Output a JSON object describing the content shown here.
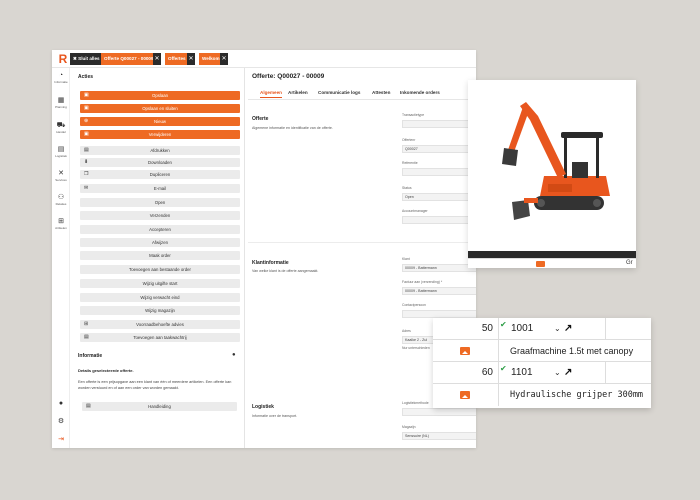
{
  "topbar": {
    "tabs": [
      {
        "label": "✖ Sluit alles",
        "color": "#2b2b2b"
      },
      {
        "label": "Offerte Q00027 - 00009",
        "color": "#ee6a23"
      },
      {
        "label": "Offertes",
        "color": "#ee6a23"
      },
      {
        "label": "Welkom",
        "color": "#ee6a23"
      }
    ],
    "logo": "R"
  },
  "sidebar": {
    "items": [
      {
        "icon": "dashboard-icon",
        "label": "Informatie"
      },
      {
        "icon": "calendar-icon",
        "label": "Planning"
      },
      {
        "icon": "cart-icon",
        "label": "Handel"
      },
      {
        "icon": "logistics-icon",
        "label": "Logistiek"
      },
      {
        "icon": "tools-icon",
        "label": "Services"
      },
      {
        "icon": "relations-icon",
        "label": "Relaties"
      },
      {
        "icon": "articles-icon",
        "label": "Artikelen"
      }
    ]
  },
  "actions": {
    "title": "Acties",
    "orange_buttons": [
      "Opslaan",
      "Opslaan en sluiten",
      "Nieuw",
      "Verwijderen"
    ],
    "gray_buttons": [
      "Afdrukken",
      "Downloaden",
      "Dupliceren",
      "E-mail",
      "Open",
      "Verzenden",
      "Accepteren",
      "Afwijzen",
      "Maak order",
      "Toevoegen aan bestaande order",
      "Wijzig uitgifte start",
      "Wijzig verwacht eind",
      "Wijzig magazijn",
      "Voorraadbehoefte advies",
      "Toevoegen aan taakwachtrij"
    ]
  },
  "info": {
    "title": "Informatie",
    "subtitle": "Details geselecteerde offerte.",
    "body": "Een offerte is een prijsopgave aan een klant van één of meerdere artikelen. Een offerte kan worden verstuurd en of aan een order van worden gemaakt.",
    "manual_button": "Handleiding"
  },
  "detail": {
    "title": "Offerte: Q00027 - 00009",
    "tabs": [
      "Algemeen",
      "Artikelen",
      "Communicatie logs",
      "Attesten",
      "Inkomende orders"
    ],
    "offerte": {
      "title": "Offerte",
      "desc": "Algemene informatie en identificatie van de offerte.",
      "fields": [
        {
          "label": "Transactietype",
          "value": ""
        },
        {
          "label": "Offertenr",
          "value": "Q00027"
        },
        {
          "label": "Referentie",
          "value": ""
        },
        {
          "label": "Status",
          "value": "Open"
        },
        {
          "label": "Accountmanager",
          "value": ""
        }
      ]
    },
    "klant": {
      "title": "Klantinformatie",
      "desc": "Van welke klant is de offerte aangemaakt.",
      "fields": [
        {
          "label": "Klant",
          "value": "00009 - Battermann"
        },
        {
          "label": "Factuur aan (verzending) *",
          "value": "00009 - Battermann"
        },
        {
          "label": "Contactpersoon",
          "value": ""
        },
        {
          "label": "Adres",
          "value": "Kaalke 2 - Zul"
        }
      ],
      "note": "Nur unterschieden"
    },
    "logistiek": {
      "title": "Logistiek",
      "desc": "Informatie over de transport.",
      "fields": [
        {
          "label": "Logistiekmethode",
          "value": ""
        },
        {
          "label": "Magazijn",
          "value": "Senssuire (NL)"
        }
      ]
    }
  },
  "image_card": {
    "footer_text": "Gr"
  },
  "lines": [
    {
      "qty": "50",
      "code": "1001",
      "desc": "Graafmachine 1.5t met canopy"
    },
    {
      "qty": "60",
      "code": "1101",
      "desc": "Hydraulische grijper 300mm"
    }
  ],
  "colors": {
    "accent": "#ee6a23",
    "check": "#2e9e47"
  }
}
